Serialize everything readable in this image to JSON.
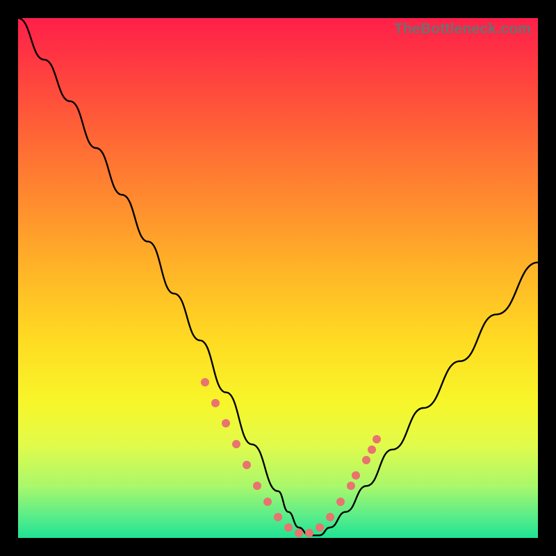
{
  "watermark": "TheBottleneck.com",
  "chart_data": {
    "type": "line",
    "title": "",
    "xlabel": "",
    "ylabel": "",
    "xlim": [
      0,
      100
    ],
    "ylim": [
      0,
      100
    ],
    "grid": false,
    "legend": false,
    "series": [
      {
        "name": "bottleneck-curve",
        "x": [
          0,
          5,
          10,
          15,
          20,
          25,
          30,
          35,
          40,
          45,
          50,
          52,
          54,
          56,
          58,
          60,
          63,
          67,
          72,
          78,
          85,
          92,
          100
        ],
        "values": [
          100,
          92,
          84,
          75,
          66,
          57,
          47,
          38,
          28,
          18,
          9,
          5,
          2,
          0.5,
          0.5,
          2,
          5,
          10,
          17,
          25,
          34,
          43,
          53
        ]
      }
    ],
    "markers": {
      "name": "highlight-dots",
      "x": [
        36,
        38,
        40,
        42,
        44,
        46,
        48,
        50,
        52,
        54,
        56,
        58,
        60,
        62,
        64,
        65,
        67,
        68,
        69
      ],
      "values": [
        30,
        26,
        22,
        18,
        14,
        10,
        7,
        4,
        2,
        1,
        1,
        2,
        4,
        7,
        10,
        12,
        15,
        17,
        19
      ]
    }
  }
}
